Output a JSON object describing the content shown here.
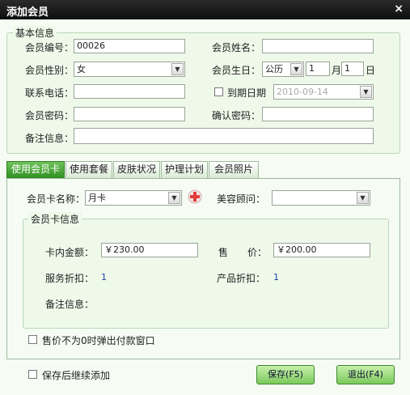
{
  "window": {
    "title": "添加会员",
    "close_glyph": "×"
  },
  "basic": {
    "legend": "基本信息",
    "member_no_label": "会员编号：",
    "member_no_value": "00026",
    "member_name_label": "会员姓名：",
    "member_name_value": "",
    "gender_label": "会员性别：",
    "gender_value": "女",
    "birthday_label": "会员生日：",
    "calendar_value": "公历",
    "month_value": "1",
    "month_unit": "月",
    "day_value": "1",
    "day_unit": "日",
    "phone_label": "联系电话：",
    "phone_value": "",
    "expire_label": "到期日期",
    "expire_value": "2010-09-14",
    "password_label": "会员密码：",
    "password_value": "",
    "confirm_label": "确认密码：",
    "confirm_value": "",
    "note_label": "备注信息：",
    "note_value": ""
  },
  "tabs": [
    "使用会员卡",
    "使用套餐",
    "皮肤状况",
    "护理计划",
    "会员照片"
  ],
  "card": {
    "card_name_label": "会员卡名称：",
    "card_name_value": "月卡",
    "consultant_label": "美容顾问：",
    "consultant_value": "",
    "info_legend": "会员卡信息",
    "balance_label": "卡内金额：",
    "balance_value": "￥230.00",
    "price_label": "售　　价：",
    "price_value": "￥200.00",
    "service_discount_label": "服务折扣：",
    "service_discount_value": "1",
    "product_discount_label": "产品折扣：",
    "product_discount_value": "1",
    "note_label": "备注信息：",
    "popup_checkbox_label": "售价不为0时弹出付款窗口"
  },
  "footer": {
    "continue_label": "保存后继续添加",
    "save_label": "保存(F5)",
    "exit_label": "退出(F4)"
  },
  "colors": {
    "titlebar": "#1a1a1a",
    "accent_green": "#3d9a2c",
    "button_green": "#9fdc7c",
    "panel": "#eef9ea"
  }
}
